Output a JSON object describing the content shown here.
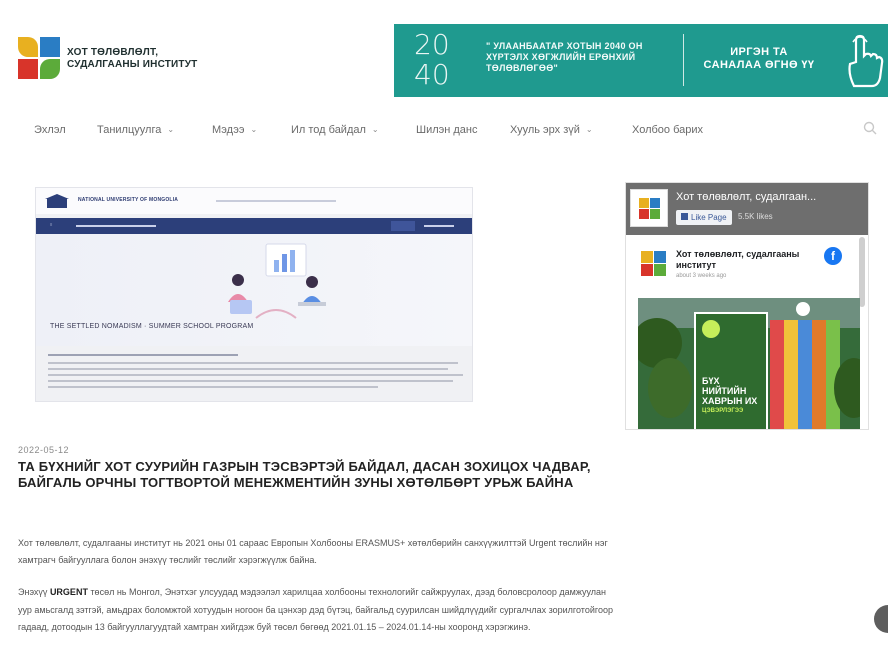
{
  "header": {
    "logo_text_line1": "ХОТ ТӨЛӨВЛӨЛТ,",
    "logo_text_line2": "СУДАЛГААНЫ ИНСТИТУТ",
    "logo_colors": [
      "#e8b020",
      "#2a7dc4",
      "#d8342a",
      "#5cab3a"
    ]
  },
  "banner": {
    "year_top": "20",
    "year_bottom": "40",
    "slogan": "\" УЛААНБААТАР ХОТЫН 2040 ОН ХҮРТЭЛХ ХӨГЖЛИЙН ЕРӨНХИЙ ТӨЛӨВЛӨГӨӨ\"",
    "cta_line1": "ИРГЭН ТА",
    "cta_line2": "САНАЛАА ӨГНӨ ҮҮ",
    "color": "#1f9a8f"
  },
  "nav": {
    "items": [
      {
        "label": "Эхлэл",
        "dropdown": false
      },
      {
        "label": "Танилцуулга",
        "dropdown": true
      },
      {
        "label": "Мэдээ",
        "dropdown": true
      },
      {
        "label": "Ил тод байдал",
        "dropdown": true
      },
      {
        "label": "Шилэн данс",
        "dropdown": false
      },
      {
        "label": "Хууль эрх зүй",
        "dropdown": true
      },
      {
        "label": "Холбоо барих",
        "dropdown": false
      }
    ],
    "chevron": "⌄",
    "search_icon": "search-icon"
  },
  "feature_image": {
    "university": "NATIONAL UNIVERSITY OF MONGOLIA",
    "hero_title": "THE SETTLED NOMADISM · SUMMER SCHOOL PROGRAM"
  },
  "article": {
    "date": "2022-05-12",
    "title": "ТА БҮХНИЙГ ХОТ СУУРИЙН ГАЗРЫН ТЭСВЭРТЭЙ БАЙДАЛ, ДАСАН ЗОХИЦОХ ЧАДВАР, БАЙГАЛЬ ОРЧНЫ ТОГТВОРТОЙ МЕНЕЖМЕНТИЙН ЗУНЫ ХӨТӨЛБӨРТ УРЬЖ БАЙНА",
    "p1": "Хот төлөвлөлт, судалгааны институт нь 2021 оны 01 сараас Европын Холбооны ERASMUS+ хөтөлбөрийн санхүүжилттэй Urgent төслийн нэг хамтрагч байгууллага болон энэхүү төслийг төслийг хэрэгжүүлж байна.",
    "p2_prefix": "Энэхүү ",
    "p2_bold": "URGENT",
    "p2_rest": " төсөл нь Монгол, Энэтхэг улсуудад мэдээлэл харилцаа холбооны технологийг сайжруулах, дээд боловсролоор дамжуулан уур амьсгалд зэтгэй, амьдрах боломжтой хотуудын ногоон ба цэнхэр дэд бүтэц, байгальд суурилсан шийдлүүдийг сургалчлах зорилготойгоор гадаад, дотоодын 13 байгууллагуудтай хамтран хийгдэж буй төсөл бөгөөд 2021.01.15 – 2024.01.14-ны хооронд хэрэгжинэ."
  },
  "facebook": {
    "page_name": "Хот төлөвлөлт, судалгаан...",
    "like_label": "Like Page",
    "likes": "5.5K likes",
    "post_author": "Хот төлөвлөлт, судалгааны институт",
    "post_time": "about 3 weeks ago",
    "card_text_line1": "БҮХ",
    "card_text_line2": "НИЙТИЙН",
    "card_text_line3": "ХАВРЫН ИХ",
    "card_highlight": "ЦЭВЭРЛЭГЭЭ"
  }
}
